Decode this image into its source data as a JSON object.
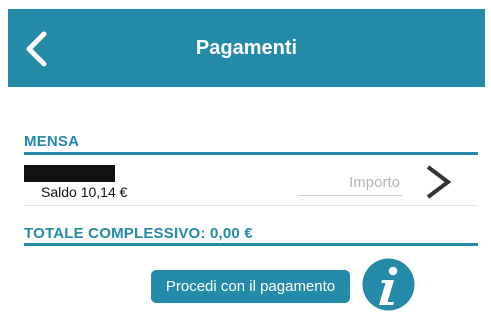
{
  "header": {
    "title": "Pagamenti",
    "back_icon": "back-chevron-icon"
  },
  "colors": {
    "accent": "#238aa8",
    "background": "#ffffff"
  },
  "mensa": {
    "title": "MENSA",
    "saldo": "Saldo 10,14 €",
    "importo_placeholder": "Importo",
    "importo_value": ""
  },
  "totale": {
    "label": "TOTALE COMPLESSIVO: 0,00 €"
  },
  "actions": {
    "pay_label": "Procedi con il pagamento",
    "info_icon": "info-icon"
  }
}
